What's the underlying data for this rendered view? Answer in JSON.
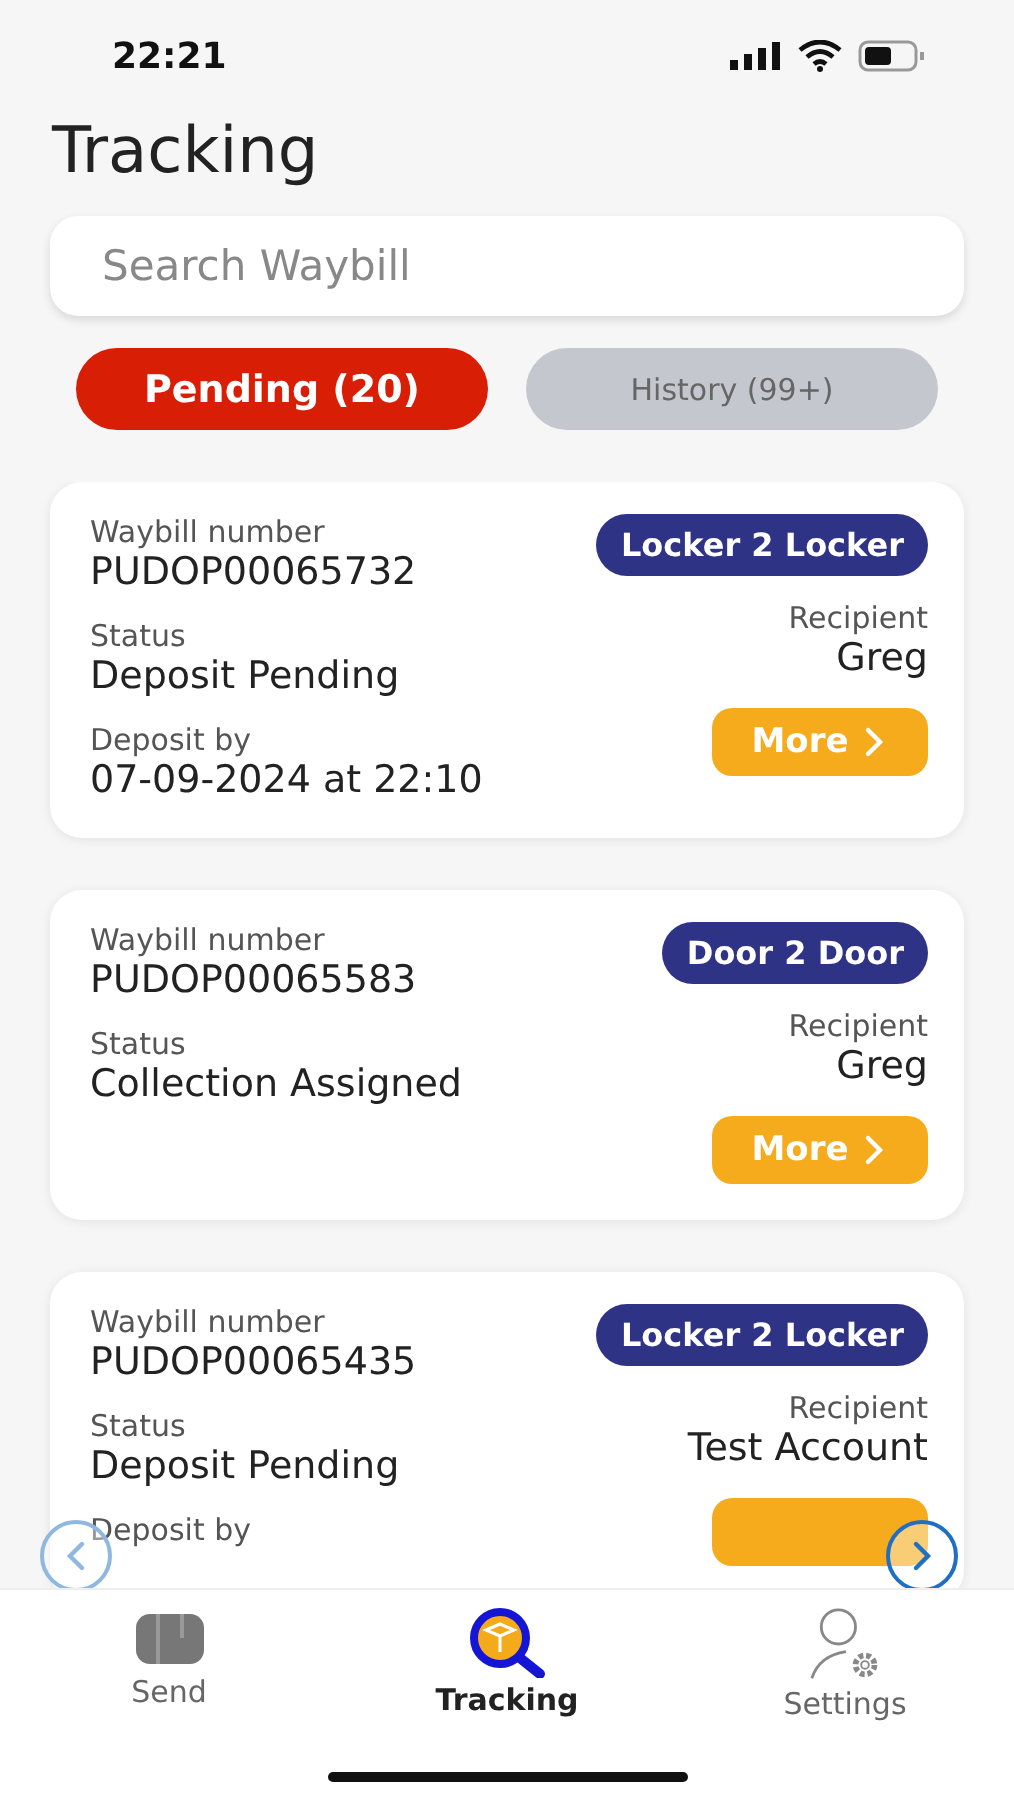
{
  "status_bar": {
    "time": "22:21"
  },
  "title": "Tracking",
  "search": {
    "placeholder": "Search Waybill"
  },
  "tabs": [
    {
      "label": "Pending (20)",
      "selected": true
    },
    {
      "label": "History (99+)",
      "selected": false
    }
  ],
  "shipments": [
    {
      "waybill_label": "Waybill number",
      "waybill": "PUDOP00065732",
      "service": "Locker 2 Locker",
      "status_label": "Status",
      "status": "Deposit Pending",
      "recipient_label": "Recipient",
      "recipient": "Greg",
      "deposit_label": "Deposit by",
      "deposit_date": "07-09-2024 at 22:10",
      "more": "More"
    },
    {
      "waybill_label": "Waybill number",
      "waybill": "PUDOP00065583",
      "service": "Door 2 Door",
      "status_label": "Status",
      "status": "Collection Assigned",
      "recipient_label": "Recipient",
      "recipient": "Greg",
      "more": "More"
    },
    {
      "waybill_label": "Waybill number",
      "waybill": "PUDOP00065435",
      "service": "Locker 2 Locker",
      "status_label": "Status",
      "status": "Deposit Pending",
      "recipient_label": "Recipient",
      "recipient": "Test Account",
      "deposit_label": "Deposit by"
    }
  ],
  "carousel": {
    "prev": {
      "disabled": true
    },
    "next": {
      "disabled": false
    }
  },
  "nav": [
    {
      "kind": "send",
      "label": "Send",
      "selected": false
    },
    {
      "kind": "tracking",
      "label": "Tracking",
      "selected": true
    },
    {
      "kind": "settings",
      "label": "Settings",
      "selected": false
    }
  ]
}
